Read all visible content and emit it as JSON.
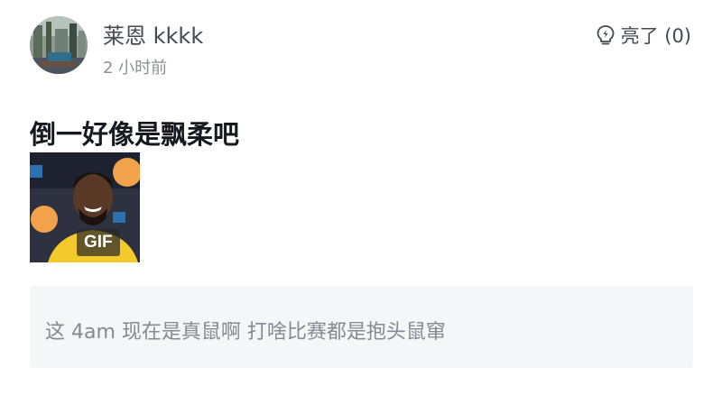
{
  "post": {
    "username": "莱恩 kkkk",
    "time": "2 小时前",
    "like_label": "亮了 (0)",
    "text": "倒一好像是飘柔吧",
    "gif_badge": "GIF",
    "quoted_reply": "这 4am 现在是真鼠啊 打啥比赛都是抱头鼠窜"
  },
  "icons": {
    "like": "lightning-bulb-icon"
  },
  "colors": {
    "quote_bg": "#f4f6f8",
    "muted_text": "#8c9096"
  }
}
